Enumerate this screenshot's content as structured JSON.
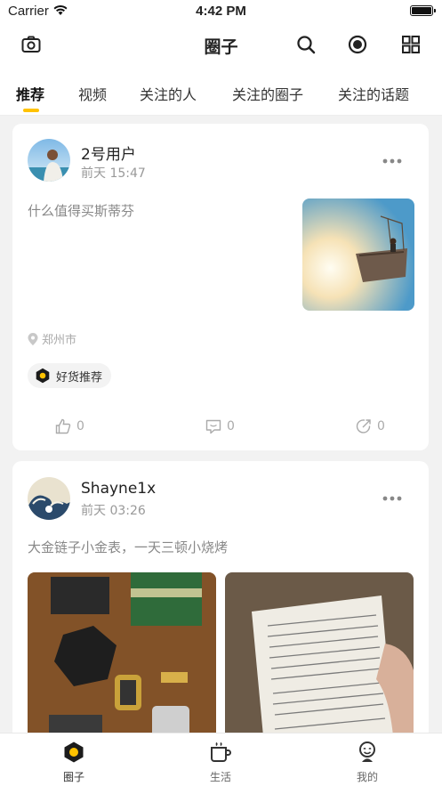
{
  "status_bar": {
    "carrier": "Carrier",
    "time": "4:42 PM",
    "battery_level": 1.0
  },
  "navbar": {
    "title": "圈子",
    "icons": [
      "camera-icon",
      "search-icon",
      "record-icon",
      "grid-icon"
    ]
  },
  "tabs": [
    {
      "label": "推荐",
      "active": true
    },
    {
      "label": "视频",
      "active": false
    },
    {
      "label": "关注的人",
      "active": false
    },
    {
      "label": "关注的圈子",
      "active": false
    },
    {
      "label": "关注的话题",
      "active": false
    }
  ],
  "posts": [
    {
      "username": "2号用户",
      "time": "前天 15:47",
      "content": "什么值得买斯蒂芬",
      "location": "郑州市",
      "tag": "好货推荐",
      "likes": "0",
      "comments": "0",
      "shares": "0"
    },
    {
      "username": "Shayne1x",
      "time": "前天 03:26",
      "content": "大金链子小金表，一天三顿小烧烤"
    }
  ],
  "tabbar": [
    {
      "label": "圈子",
      "icon": "circle-hexagon-icon",
      "active": true,
      "color": "#ffc200"
    },
    {
      "label": "生活",
      "icon": "cup-icon",
      "active": false
    },
    {
      "label": "我的",
      "icon": "profile-icon",
      "active": false
    }
  ]
}
